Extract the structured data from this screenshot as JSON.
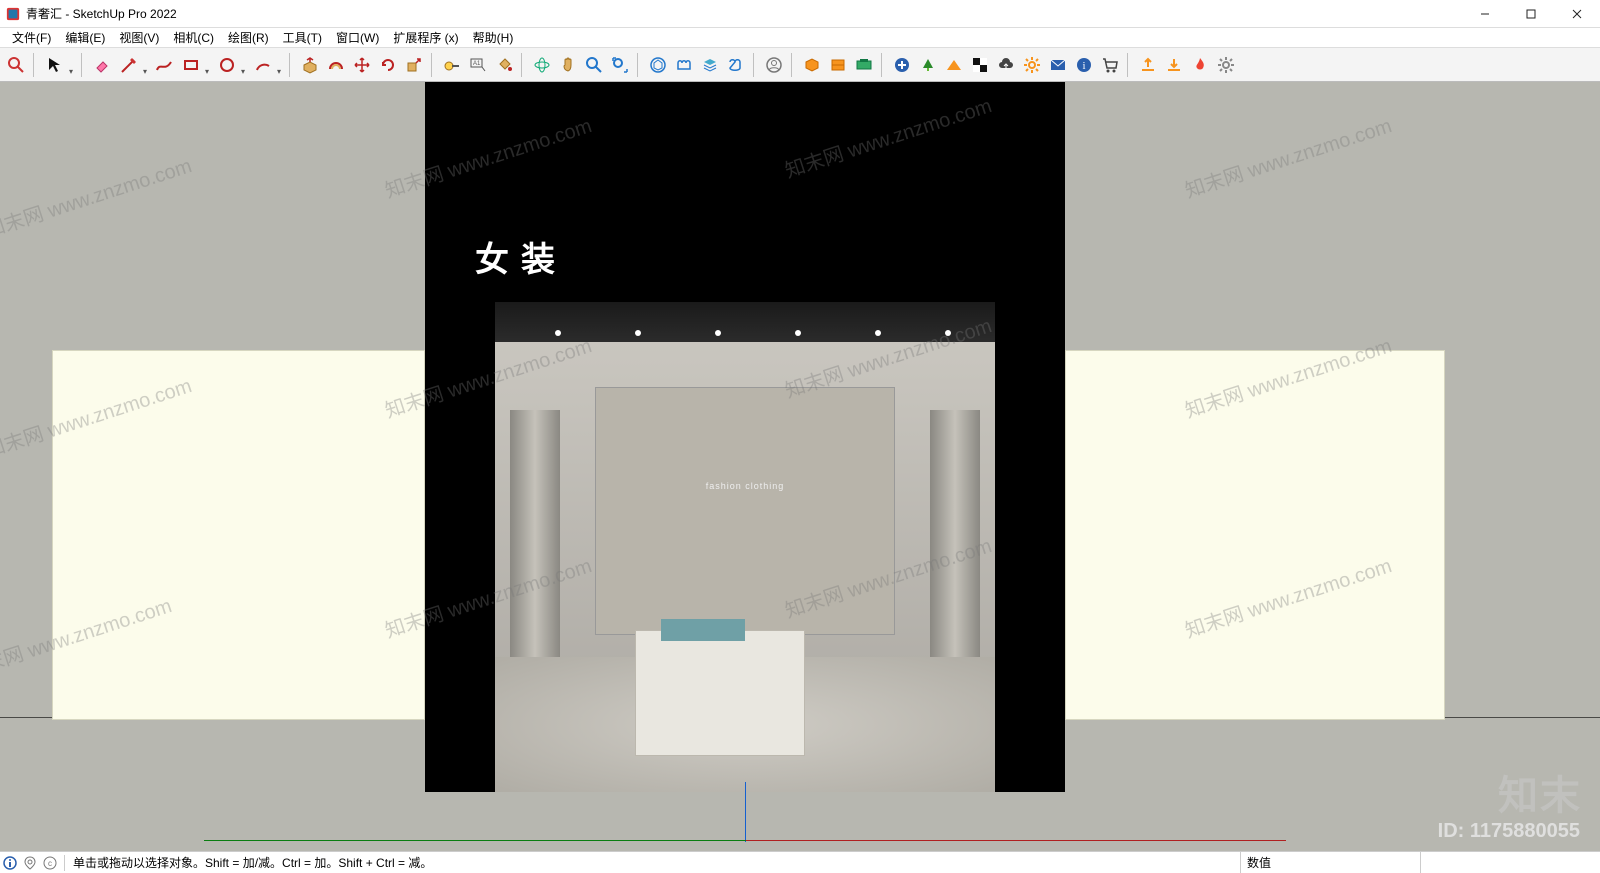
{
  "window": {
    "title": "青奢汇 - SketchUp Pro 2022",
    "min_tip": "最小化",
    "max_tip": "还原",
    "close_tip": "关闭"
  },
  "menu": {
    "file": "文件(F)",
    "edit": "编辑(E)",
    "view": "视图(V)",
    "camera": "相机(C)",
    "draw": "绘图(R)",
    "tools": "工具(T)",
    "window": "窗口(W)",
    "ext": "扩展程序 (x)",
    "help": "帮助(H)"
  },
  "toolbar_icons": {
    "search": "search-icon",
    "select": "select-arrow-icon",
    "eraser": "eraser-icon",
    "pencil": "pencil-icon",
    "freehand": "freehand-icon",
    "rect": "rectangle-icon",
    "circle": "circle-icon",
    "arc": "arc-icon",
    "pushpull": "push-pull-icon",
    "offset": "offset-icon",
    "move": "move-icon",
    "rotate": "rotate-icon",
    "scale": "scale-icon",
    "tape": "tape-measure-icon",
    "text": "text-label-icon",
    "paint": "paint-bucket-icon",
    "orbit": "orbit-icon",
    "pan": "pan-hand-icon",
    "zoom": "zoom-icon",
    "zoomext": "zoom-extents-icon",
    "warehouse1": "3d-warehouse-icon",
    "extwh": "extension-warehouse-icon",
    "layers": "layers-icon",
    "outliner": "outliner-icon",
    "account": "account-icon",
    "vray1": "vray-asset-icon",
    "vray2": "vray-frame-icon",
    "vray3": "vray-render-icon",
    "addscene": "add-scene-icon",
    "tree": "tree-icon",
    "sandbox": "sandbox-icon",
    "checker": "checker-icon",
    "cloud": "cloud-icon",
    "gear1": "settings-icon",
    "mail": "mail-icon",
    "info": "info-icon",
    "cart": "cart-icon",
    "export1": "export-icon",
    "import1": "import-icon",
    "flame": "flame-icon",
    "gear2": "gear-icon"
  },
  "scene": {
    "sign_text": "女装",
    "interior_wall_text": "fashion clothing"
  },
  "watermark": {
    "repeat_text": "知末网 www.znzmo.com",
    "brand": "知末",
    "id_label": "ID: 1175880055"
  },
  "status": {
    "hint": "单击或拖动以选择对象。Shift = 加/减。Ctrl = 加。Shift + Ctrl = 减。",
    "value_label": "数值"
  }
}
